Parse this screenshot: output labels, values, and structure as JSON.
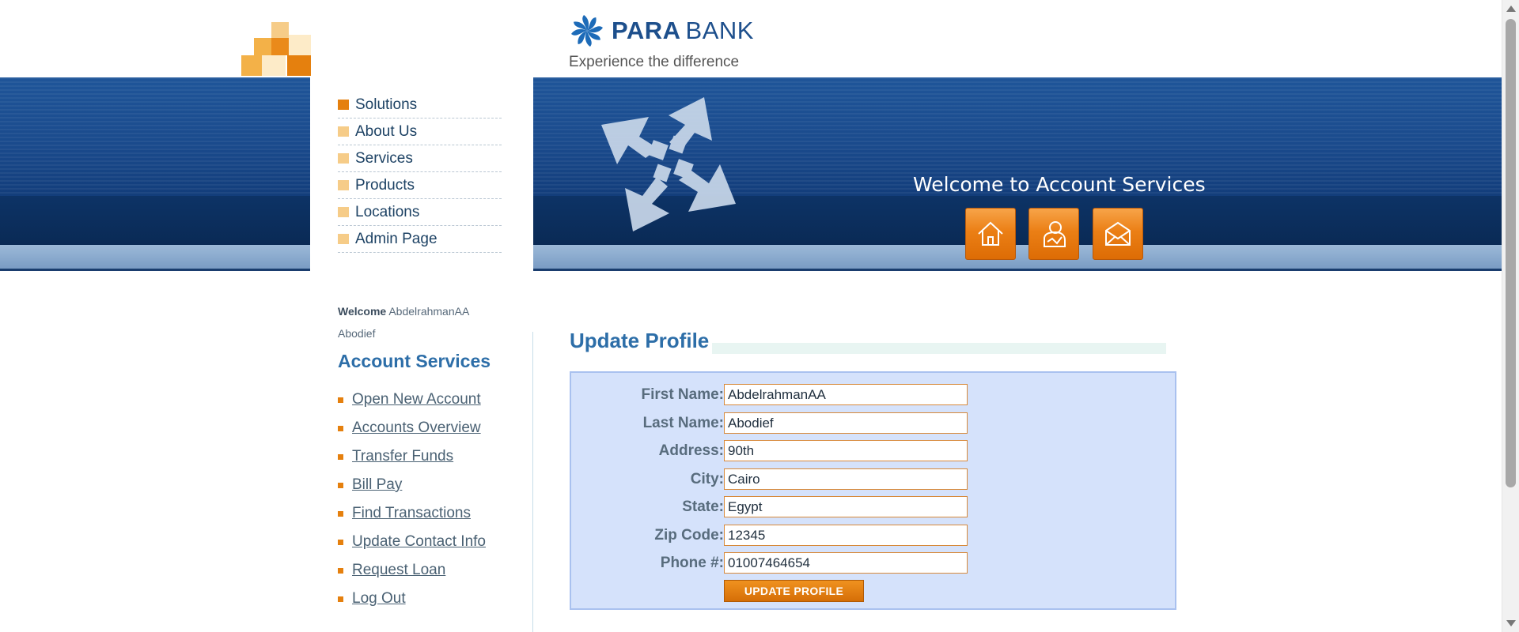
{
  "brand": {
    "name_bold": "PARA",
    "name_light": "BANK",
    "tagline": "Experience the difference"
  },
  "top_nav": {
    "items": [
      {
        "label": "Solutions",
        "active": true
      },
      {
        "label": "About Us",
        "active": false
      },
      {
        "label": "Services",
        "active": false
      },
      {
        "label": "Products",
        "active": false
      },
      {
        "label": "Locations",
        "active": false
      },
      {
        "label": "Admin Page",
        "active": false
      }
    ]
  },
  "hero": {
    "title": "Welcome to Account Services",
    "buttons": [
      {
        "icon": "home-icon",
        "name": "home"
      },
      {
        "icon": "about-icon",
        "name": "about"
      },
      {
        "icon": "contact-icon",
        "name": "contact"
      }
    ]
  },
  "sidebar": {
    "welcome_label": "Welcome",
    "user_name": "AbdelrahmanAA Abodief",
    "section_title": "Account Services",
    "links": [
      {
        "label": "Open New Account"
      },
      {
        "label": "Accounts Overview"
      },
      {
        "label": "Transfer Funds"
      },
      {
        "label": "Bill Pay"
      },
      {
        "label": "Find Transactions"
      },
      {
        "label": "Update Contact Info"
      },
      {
        "label": "Request Loan"
      },
      {
        "label": "Log Out"
      }
    ]
  },
  "main": {
    "title": "Update Profile",
    "fields": [
      {
        "label": "First Name:",
        "value": "AbdelrahmanAA"
      },
      {
        "label": "Last Name:",
        "value": "Abodief"
      },
      {
        "label": "Address:",
        "value": "90th"
      },
      {
        "label": "City:",
        "value": "Cairo"
      },
      {
        "label": "State:",
        "value": "Egypt"
      },
      {
        "label": "Zip Code:",
        "value": "12345"
      },
      {
        "label": "Phone #:",
        "value": "01007464654"
      }
    ],
    "submit_label": "UPDATE PROFILE"
  },
  "colors": {
    "brand_blue": "#1d4f8c",
    "accent_orange": "#e5800e",
    "form_background": "#d5e2fb",
    "heading_blue": "#2d6ea8"
  }
}
